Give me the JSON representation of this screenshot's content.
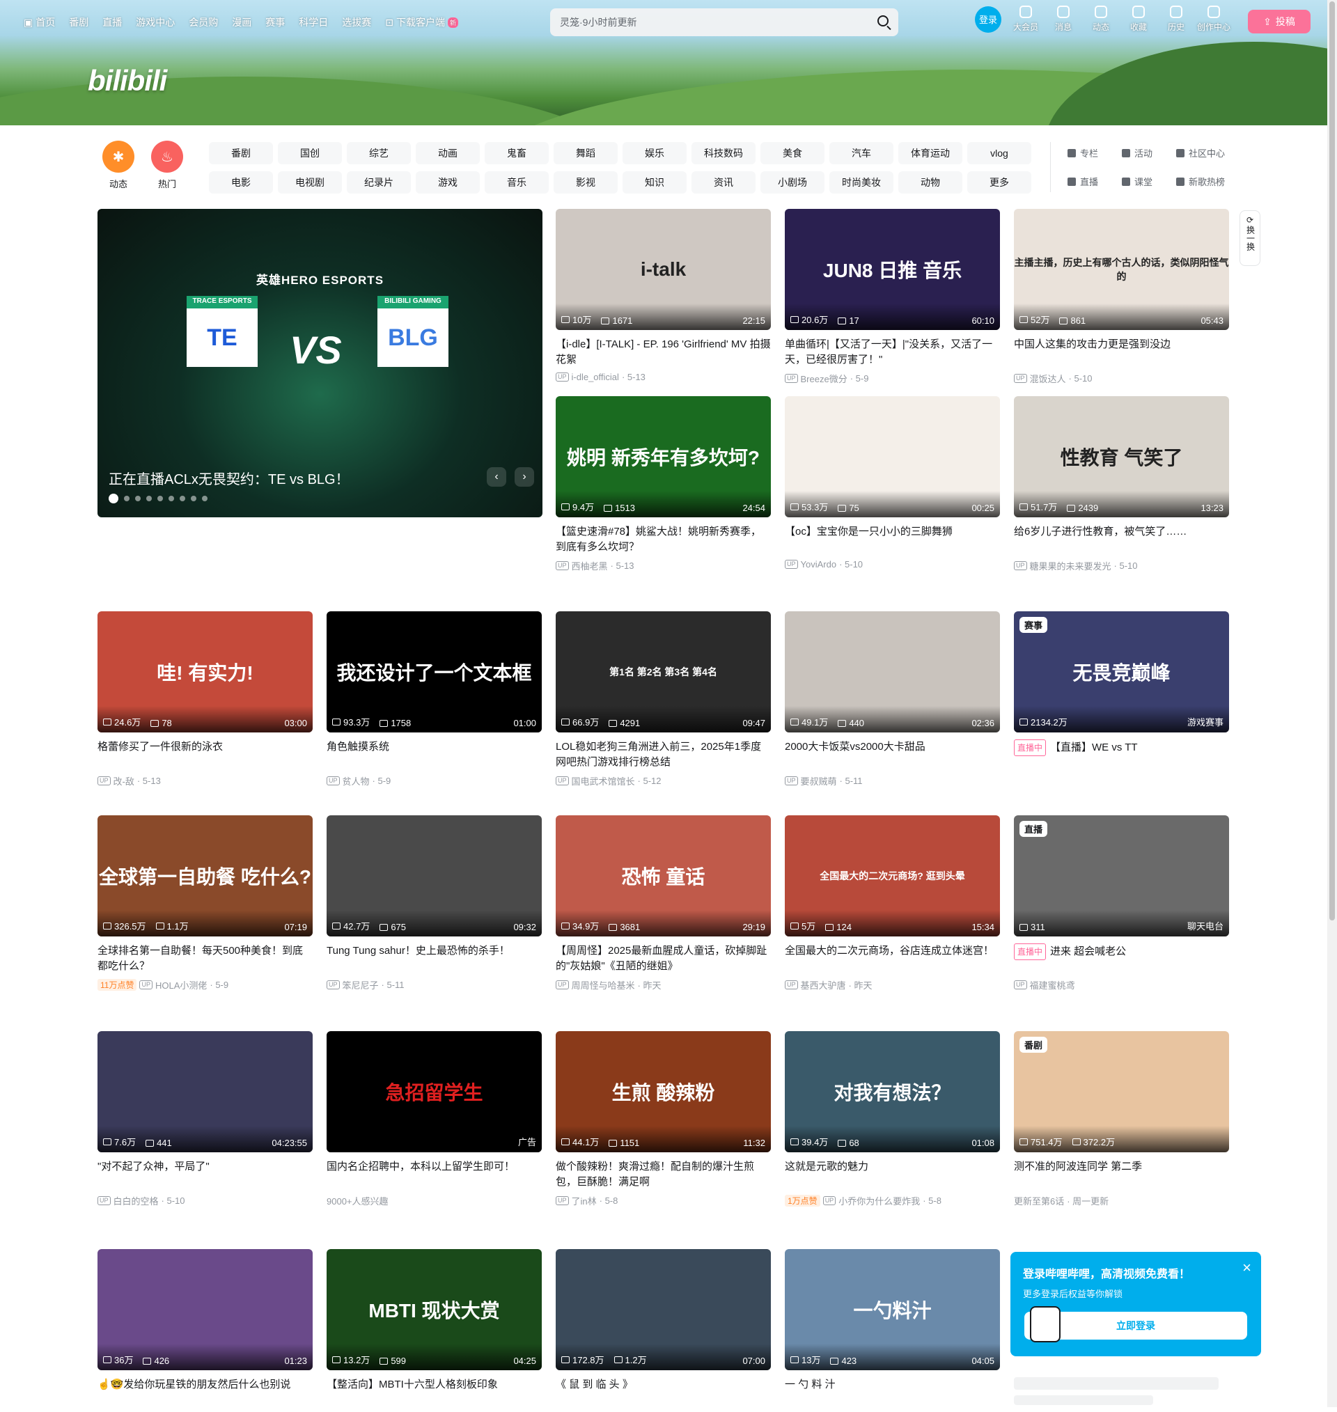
{
  "nav": {
    "left": [
      "首页",
      "番剧",
      "直播",
      "游戏中心",
      "会员购",
      "漫画",
      "赛事",
      "科学日",
      "选拔赛",
      "下载客户端"
    ],
    "new_badge": "新",
    "search_placeholder": "灵笼·9小时前更新",
    "login": "登录",
    "right": [
      "大会员",
      "消息",
      "动态",
      "收藏",
      "历史",
      "创作中心"
    ],
    "upload": "投稿"
  },
  "logo": "bilibili",
  "channels": {
    "big": [
      {
        "label": "动态",
        "color": "#ff8e29"
      },
      {
        "label": "热门",
        "color": "#f9625f"
      }
    ],
    "tags": [
      "番剧",
      "国创",
      "综艺",
      "动画",
      "鬼畜",
      "舞蹈",
      "娱乐",
      "科技数码",
      "美食",
      "汽车",
      "体育运动",
      "vlog",
      "电影",
      "电视剧",
      "纪录片",
      "游戏",
      "音乐",
      "影视",
      "知识",
      "资讯",
      "小剧场",
      "时尚美妆",
      "动物",
      "更多"
    ],
    "side": [
      "专栏",
      "活动",
      "社区中心",
      "直播",
      "课堂",
      "新歌热榜"
    ]
  },
  "carousel": {
    "title": "正在直播ACLx无畏契约：TE vs BLG！",
    "top_text": "英雄HERO ESPORTS",
    "team_left": "TRACE ESPORTS",
    "team_right": "BILIBILI GAMING",
    "vs": "VS",
    "prev": "‹",
    "next": "›",
    "dot_count": 9
  },
  "refresh": "换一换",
  "cards": [
    {
      "views": "10万",
      "danmaku": "1671",
      "dur": "22:15",
      "title": "【i-dle】[I-TALK] - EP. 196 'Girlfriend' MV 拍摄 花絮",
      "author": "i-dle_official",
      "date": "5-13",
      "bg": "#cfc8c2",
      "overlay": "i-talk"
    },
    {
      "views": "20.6万",
      "danmaku": "17",
      "dur": "60:10",
      "title": "单曲循环|【又活了一天】|\"没关系，又活了一天，已经很厉害了！\"",
      "author": "Breeze微分",
      "date": "5-9",
      "bg": "#2a2050",
      "overlay": "JUN8 日推 音乐"
    },
    {
      "views": "52万",
      "danmaku": "861",
      "dur": "05:43",
      "title": "中国人这集的攻击力更是强到没边",
      "author": "混饭达人",
      "date": "5-10",
      "bg": "#eae2da",
      "overlay": "主播主播，历史上有哪个古人的话，类似阴阳怪气的"
    },
    {
      "views": "9.4万",
      "danmaku": "1513",
      "dur": "24:54",
      "title": "【篮史速滑#78】姚鲨大战！姚明新秀赛季，到底有多么坎坷？",
      "author": "西柚老黑",
      "date": "5-13",
      "bg": "#1a6b20",
      "overlay": "姚明 新秀年有多坎坷?"
    },
    {
      "views": "53.3万",
      "danmaku": "75",
      "dur": "00:25",
      "title": "【oc】宝宝你是一只小小的三脚舞狮",
      "author": "YoviArdo",
      "date": "5-10",
      "bg": "#f4efe9",
      "overlay": ""
    },
    {
      "views": "51.7万",
      "danmaku": "2439",
      "dur": "13:23",
      "title": "给6岁儿子进行性教育，被气笑了……",
      "author": "糖果果的未来要发光",
      "date": "5-10",
      "bg": "#d9d4cc",
      "overlay": "性教育 气笑了"
    },
    {
      "views": "24.6万",
      "danmaku": "78",
      "dur": "03:00",
      "title": "格蕾修买了一件很新的泳衣",
      "author": "改-敌",
      "date": "5-13",
      "bg": "#c44a3a",
      "overlay": "哇! 有实力!"
    },
    {
      "views": "93.3万",
      "danmaku": "1758",
      "dur": "01:00",
      "title": "角色触摸系统",
      "author": "贫人物",
      "date": "5-9",
      "bg": "#000000",
      "overlay": "我还设计了一个文本框"
    },
    {
      "views": "66.9万",
      "danmaku": "4291",
      "dur": "09:47",
      "title": "LOL稳如老狗三角洲进入前三，2025年1季度网吧热门游戏排行榜总结",
      "author": "国电武术馆馆长",
      "date": "5-12",
      "bg": "#2b2b2b",
      "overlay": "第1名 第2名 第3名 第4名"
    },
    {
      "views": "49.1万",
      "danmaku": "440",
      "dur": "02:36",
      "title": "2000大卡饭菜vs2000大卡甜品",
      "author": "要叔贼萌",
      "date": "5-11",
      "bg": "#c9c3bd",
      "overlay": ""
    },
    {
      "views": "2134.2万",
      "danmaku": "",
      "dur": "游戏赛事",
      "title": "【直播】WE vs TT",
      "author": "",
      "date": "",
      "bg": "#3a3f6e",
      "overlay": "无畏竞巅峰",
      "corner": "赛事",
      "live": "直播中"
    },
    {
      "views": "326.5万",
      "danmaku": "1.1万",
      "dur": "07:19",
      "title": "全球排名第一自助餐！每天500种美食！到底都吃什么？",
      "author": "HOLA小测佬",
      "date": "5-9",
      "bg": "#8a4a2a",
      "overlay": "全球第一自助餐 吃什么?",
      "hot": "11万点赞"
    },
    {
      "views": "42.7万",
      "danmaku": "675",
      "dur": "09:32",
      "title": "Tung Tung sahur！史上最恐怖的杀手！",
      "author": "笨尼尼子",
      "date": "5-11",
      "bg": "#4a4a4a",
      "overlay": ""
    },
    {
      "views": "34.9万",
      "danmaku": "3681",
      "dur": "29:19",
      "title": "【周周怪】2025最新血腥成人童话，砍掉脚趾的\"灰姑娘\"《丑陋的继姐》",
      "author": "周周怪与哈基米",
      "date": "昨天",
      "bg": "#c05a4a",
      "overlay": "恐怖 童话"
    },
    {
      "views": "5万",
      "danmaku": "124",
      "dur": "15:34",
      "title": "全国最大的二次元商场，谷店连成立体迷宫！",
      "author": "基西大驴唐",
      "date": "昨天",
      "bg": "#b84a3a",
      "overlay": "全国最大的二次元商场? 逛到头晕"
    },
    {
      "views": "311",
      "danmaku": "",
      "dur": "聊天电台",
      "title": "进来 超会喊老公",
      "author": "福建蜜桃鸢",
      "date": "",
      "bg": "#6a6a6a",
      "overlay": "",
      "corner": "直播",
      "live": "直播中"
    },
    {
      "views": "7.6万",
      "danmaku": "441",
      "dur": "04:23:55",
      "title": "\"对不起了众神，平局了\"",
      "author": "白白的空格",
      "date": "5-10",
      "bg": "#3a3a5a",
      "overlay": ""
    },
    {
      "views": "",
      "danmaku": "",
      "dur": "广告",
      "title": "国内名企招聘中，本科以上留学生即可！",
      "author": "9000+人感兴趣",
      "date": "",
      "bg": "#000000",
      "overlay": "急招留学生"
    },
    {
      "views": "44.1万",
      "danmaku": "1151",
      "dur": "11:32",
      "title": "做个酸辣粉！爽滑过瘾！配自制的爆汁生煎包，巨酥脆！满足啊",
      "author": "了in林",
      "date": "5-8",
      "bg": "#8a3a1a",
      "overlay": "生煎 酸辣粉"
    },
    {
      "views": "39.4万",
      "danmaku": "68",
      "dur": "01:08",
      "title": "这就是元歌的魅力",
      "author": "小乔你为什么要炸我",
      "date": "5-8",
      "bg": "#3a5a6a",
      "overlay": "对我有想法？",
      "hot": "1万点赞"
    },
    {
      "views": "751.4万",
      "danmaku": "372.2万",
      "dur": "",
      "title": "测不准的阿波连同学 第二季",
      "author": "更新至第6话",
      "date": "周一更新",
      "bg": "#e8c4a0",
      "overlay": "",
      "corner": "番剧"
    },
    {
      "views": "36万",
      "danmaku": "426",
      "dur": "01:23",
      "title": "☝️🤓发给你玩星铁的朋友然后什么也别说",
      "author": "",
      "date": "",
      "bg": "#6a4a8a",
      "overlay": ""
    },
    {
      "views": "13.2万",
      "danmaku": "599",
      "dur": "04:25",
      "title": "【整活向】MBTI十六型人格刻板印象",
      "author": "",
      "date": "",
      "bg": "#1a4a1a",
      "overlay": "MBTI 现状大赏"
    },
    {
      "views": "172.8万",
      "danmaku": "1.2万",
      "dur": "07:00",
      "title": "《 鼠 到 临 头 》",
      "author": "",
      "date": "",
      "bg": "#3a4a5a",
      "overlay": ""
    },
    {
      "views": "13万",
      "danmaku": "423",
      "dur": "04:05",
      "title": "一 勺 料 汁",
      "author": "",
      "date": "",
      "bg": "#6a8aaa",
      "overlay": "一勺料汁"
    }
  ],
  "login_popup": {
    "title": "登录哔哩哔哩，高清视频免费看！",
    "sub": "更多登录后权益等你解锁",
    "button": "立即登录",
    "close": "×"
  }
}
